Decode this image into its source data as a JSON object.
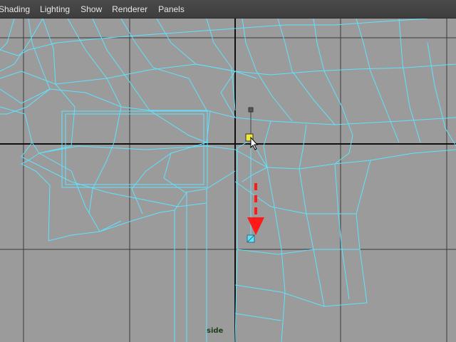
{
  "menubar": {
    "items": [
      {
        "label": "Shading"
      },
      {
        "label": "Lighting"
      },
      {
        "label": "Show"
      },
      {
        "label": "Renderer"
      },
      {
        "label": "Panels"
      }
    ]
  },
  "viewport": {
    "camera_label": "side",
    "background_color": "#9b9b9b",
    "wire_color": "#5fe3ff",
    "selected_vertex_color": "#f2ea3a",
    "arrow_color": "#ff1a1a"
  }
}
